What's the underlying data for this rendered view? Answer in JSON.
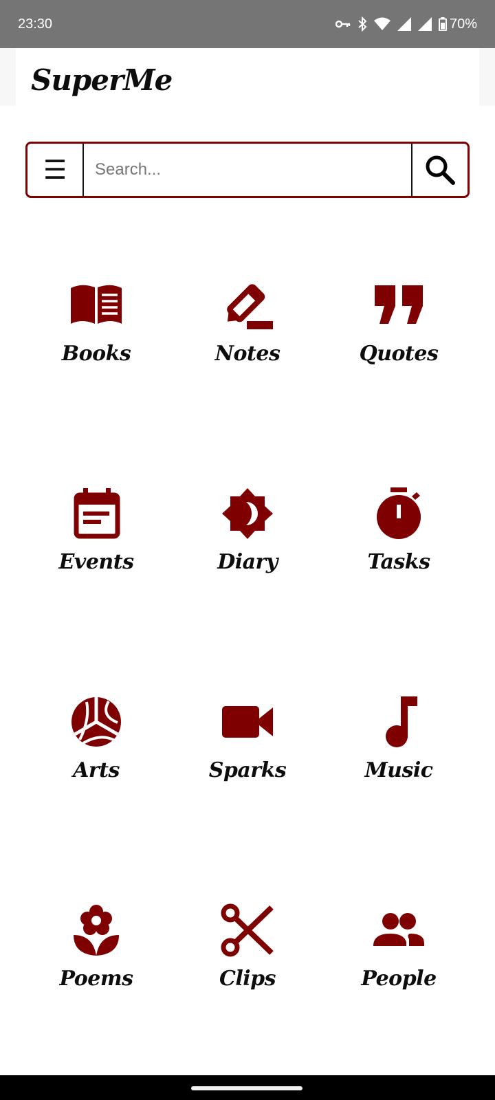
{
  "status": {
    "time": "23:30",
    "battery": "70%"
  },
  "app": {
    "title": "SuperMe"
  },
  "search": {
    "placeholder": "Search...",
    "menu_glyph": "☰"
  },
  "colors": {
    "accent": "#7f0000",
    "status_bar": "#757575"
  },
  "categories": [
    {
      "label": "Books",
      "icon": "book-icon"
    },
    {
      "label": "Notes",
      "icon": "pencil-icon"
    },
    {
      "label": "Quotes",
      "icon": "quote-icon"
    },
    {
      "label": "Events",
      "icon": "calendar-icon"
    },
    {
      "label": "Diary",
      "icon": "brightness-icon"
    },
    {
      "label": "Tasks",
      "icon": "stopwatch-icon"
    },
    {
      "label": "Arts",
      "icon": "volleyball-icon"
    },
    {
      "label": "Sparks",
      "icon": "video-camera-icon"
    },
    {
      "label": "Music",
      "icon": "music-note-icon"
    },
    {
      "label": "Poems",
      "icon": "flower-icon"
    },
    {
      "label": "Clips",
      "icon": "scissors-icon"
    },
    {
      "label": "People",
      "icon": "people-icon"
    }
  ]
}
